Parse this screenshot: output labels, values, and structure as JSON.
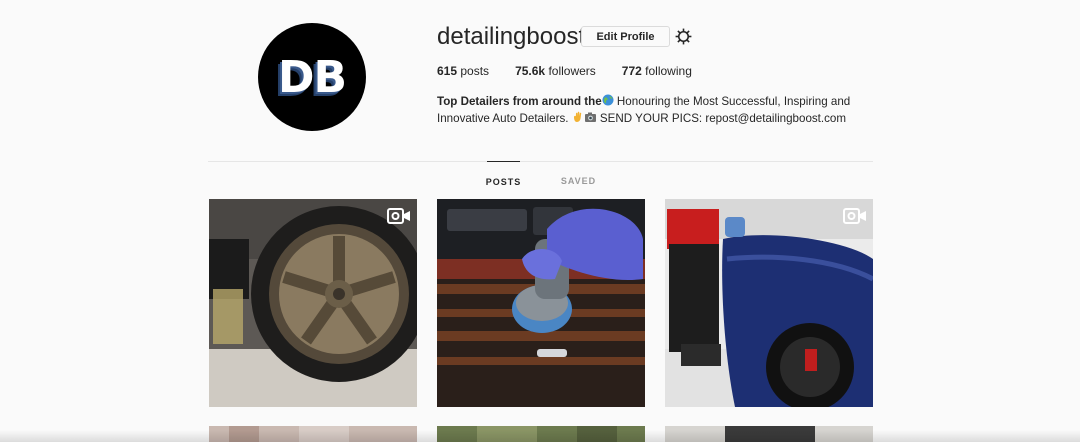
{
  "profile": {
    "avatar_text": "DB",
    "username": "detailingboost",
    "edit_label": "Edit Profile",
    "posts_count": "615",
    "posts_label": "posts",
    "followers_count": "75.6k",
    "followers_label": "followers",
    "following_count": "772",
    "following_label": "following",
    "bio_bold": "Top Detailers from around the",
    "bio_line1_rest": " Honouring the Most Successful, Inspiring and",
    "bio_line2_pre": "Innovative Auto Detailers. ",
    "bio_line2_post": " SEND YOUR PICS: repost@detailingboost.com"
  },
  "tabs": {
    "posts": "POSTS",
    "saved": "SAVED"
  },
  "grid": {
    "tiles": [
      {
        "subject": "wheel-being-cleaned",
        "video": true
      },
      {
        "subject": "interior-console-polishing",
        "video": false
      },
      {
        "subject": "blue-car-detailing",
        "video": true
      },
      {
        "subject": "garage-shop",
        "video": false
      },
      {
        "subject": "car-outdoors",
        "video": false
      },
      {
        "subject": "car-detail",
        "video": false
      }
    ]
  },
  "icons": {
    "settings": "gear-icon",
    "video": "video-camera-icon",
    "globe": "globe-emoji",
    "hand": "hand-emoji",
    "camera": "camera-emoji"
  },
  "colors": {
    "background": "#fafafa",
    "text": "#262626",
    "muted": "#999999",
    "border": "#dbdbdb"
  }
}
